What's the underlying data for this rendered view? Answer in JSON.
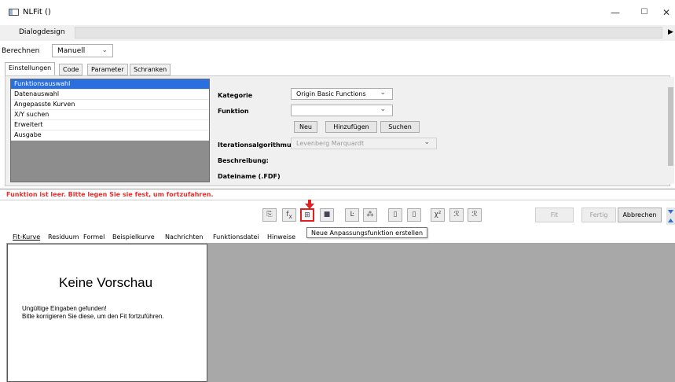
{
  "window": {
    "title": "NLFit ()",
    "minimize": "—",
    "maximize": "☐",
    "close": "✕"
  },
  "design": {
    "label": "Dialogdesign",
    "arrow": "▶"
  },
  "calculate": {
    "label": "Berechnen",
    "value": "Manuell"
  },
  "top_tabs": [
    "Einstellungen",
    "Code",
    "Parameter",
    "Schranken"
  ],
  "nav": {
    "items": [
      "Funktionsauswahl",
      "Datenauswahl",
      "Angepasste Kurven",
      "X/Y suchen",
      "Erweitert",
      "Ausgabe"
    ],
    "selected": "Funktionsauswahl"
  },
  "form": {
    "category_label": "Kategorie",
    "category_value": "Origin Basic Functions",
    "function_label": "Funktion",
    "function_value": "",
    "btn_new": "Neu",
    "btn_add": "Hinzufügen",
    "btn_search": "Suchen",
    "iteration_label": "Iterationsalgorithmus",
    "iteration_value": "Levenberg Marquardt",
    "description_label": "Beschreibung:",
    "filename_label": "Dateiname (.FDF)"
  },
  "error": "Funktion ist leer. Bitte legen Sie sie fest, um fortzufahren.",
  "toolbar": {
    "tooltip": "Neue Anpassungsfunktion erstellen",
    "fit": "Fit",
    "done": "Fertig",
    "cancel": "Abbrechen"
  },
  "bottom_tabs": [
    "Fit-Kurve",
    "Residuum",
    "Formel",
    "Beispielkurve",
    "Nachrichten",
    "Funktionsdatei",
    "Hinweise"
  ],
  "preview": {
    "title": "Keine Vorschau",
    "line1": "Ungültige Eingaben gefunden!",
    "line2": "Bitte korrigieren Sie diese, um den Fit fortzuführen."
  },
  "colors": {
    "error": "#e53030",
    "selection": "#2a6fe0",
    "highlight": "#e02020",
    "preview_bg": "#a8a8a8"
  }
}
